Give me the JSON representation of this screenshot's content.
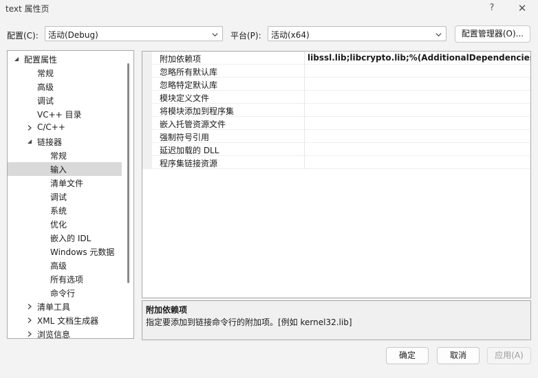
{
  "window": {
    "title": "text 属性页",
    "help_glyph": "?",
    "close_glyph": "✕"
  },
  "toolbar": {
    "config_label": "配置(C):",
    "config_value": "活动(Debug)",
    "platform_label": "平台(P):",
    "platform_value": "活动(x64)",
    "config_manager_label": "配置管理器(O)..."
  },
  "tree": {
    "items": [
      {
        "label": "配置属性",
        "level": 0,
        "expander": "expanded"
      },
      {
        "label": "常规",
        "level": 1,
        "expander": "none"
      },
      {
        "label": "高级",
        "level": 1,
        "expander": "none"
      },
      {
        "label": "调试",
        "level": 1,
        "expander": "none"
      },
      {
        "label": "VC++ 目录",
        "level": 1,
        "expander": "none"
      },
      {
        "label": "C/C++",
        "level": 1,
        "expander": "collapsed"
      },
      {
        "label": "链接器",
        "level": 1,
        "expander": "expanded"
      },
      {
        "label": "常规",
        "level": 2,
        "expander": "none"
      },
      {
        "label": "输入",
        "level": 2,
        "expander": "none",
        "selected": true
      },
      {
        "label": "清单文件",
        "level": 2,
        "expander": "none"
      },
      {
        "label": "调试",
        "level": 2,
        "expander": "none"
      },
      {
        "label": "系统",
        "level": 2,
        "expander": "none"
      },
      {
        "label": "优化",
        "level": 2,
        "expander": "none"
      },
      {
        "label": "嵌入的 IDL",
        "level": 2,
        "expander": "none"
      },
      {
        "label": "Windows 元数据",
        "level": 2,
        "expander": "none"
      },
      {
        "label": "高级",
        "level": 2,
        "expander": "none"
      },
      {
        "label": "所有选项",
        "level": 2,
        "expander": "none"
      },
      {
        "label": "命令行",
        "level": 2,
        "expander": "none"
      },
      {
        "label": "清单工具",
        "level": 1,
        "expander": "collapsed"
      },
      {
        "label": "XML 文档生成器",
        "level": 1,
        "expander": "collapsed"
      },
      {
        "label": "浏览信息",
        "level": 1,
        "expander": "collapsed"
      }
    ]
  },
  "properties": {
    "rows": [
      {
        "name": "附加依赖项",
        "value": "libssl.lib;libcrypto.lib;%(AdditionalDependencies)"
      },
      {
        "name": "忽略所有默认库",
        "value": ""
      },
      {
        "name": "忽略特定默认库",
        "value": ""
      },
      {
        "name": "模块定义文件",
        "value": ""
      },
      {
        "name": "将模块添加到程序集",
        "value": ""
      },
      {
        "name": "嵌入托管资源文件",
        "value": ""
      },
      {
        "name": "强制符号引用",
        "value": ""
      },
      {
        "name": "延迟加载的 DLL",
        "value": ""
      },
      {
        "name": "程序集链接资源",
        "value": ""
      }
    ]
  },
  "description": {
    "title": "附加依赖项",
    "text": "指定要添加到链接命令行的附加项。[例如 kernel32.lib]"
  },
  "buttons": {
    "ok": "确定",
    "cancel": "取消",
    "apply": "应用(A)"
  }
}
